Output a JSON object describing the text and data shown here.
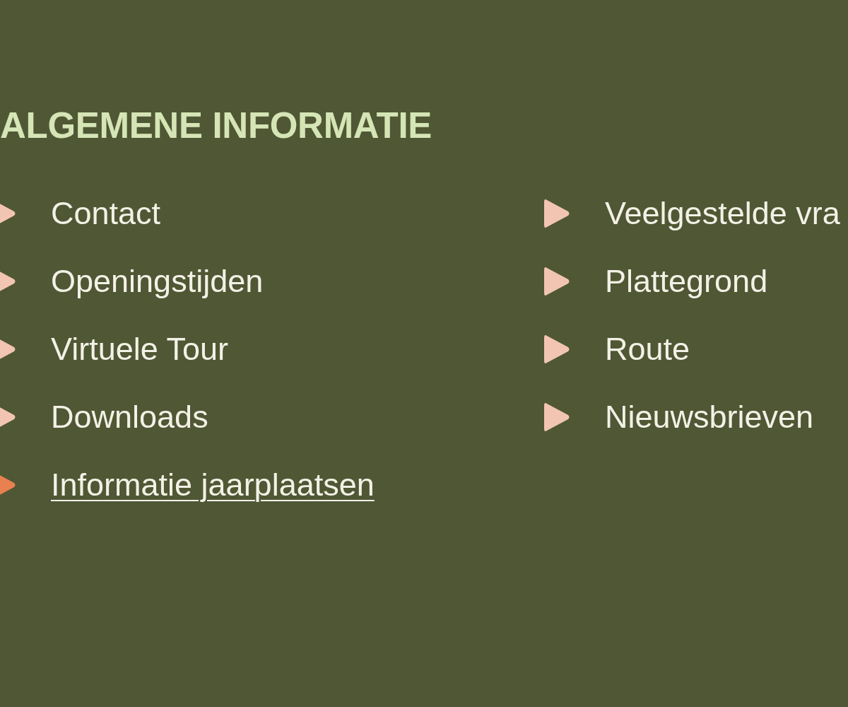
{
  "heading": "ALGEMENE INFORMATIE",
  "columns": [
    {
      "links": [
        {
          "label": "Contact",
          "selected": false
        },
        {
          "label": "Openingstijden",
          "selected": false
        },
        {
          "label": "Virtuele Tour",
          "selected": false
        },
        {
          "label": "Downloads",
          "selected": false
        },
        {
          "label": "Informatie jaarplaatsen",
          "selected": true
        }
      ]
    },
    {
      "links": [
        {
          "label": "Veelgestelde vra",
          "selected": false
        },
        {
          "label": "Plattegrond",
          "selected": false
        },
        {
          "label": "Route",
          "selected": false
        },
        {
          "label": "Nieuwsbrieven",
          "selected": false
        }
      ]
    }
  ]
}
